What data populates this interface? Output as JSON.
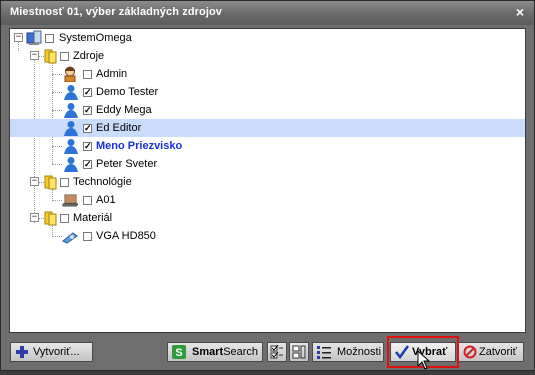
{
  "window": {
    "title": "Miestnosť 01, výber základných zdrojov",
    "close_label": "×"
  },
  "tree": {
    "root": {
      "label": "SystemOmega",
      "checked": false,
      "icon": "system-icon"
    },
    "groups": [
      {
        "label": "Zdroje",
        "checked": false,
        "icon": "folder-icon",
        "items": [
          {
            "label": "Admin",
            "checked": false,
            "icon": "admin-user-icon",
            "selected": false,
            "highlight": false
          },
          {
            "label": "Demo Tester",
            "checked": true,
            "icon": "user-icon",
            "selected": false,
            "highlight": false
          },
          {
            "label": "Eddy Mega",
            "checked": true,
            "icon": "user-icon",
            "selected": false,
            "highlight": false
          },
          {
            "label": "Ed Editor",
            "checked": true,
            "icon": "user-icon",
            "selected": true,
            "highlight": false
          },
          {
            "label": "Meno Priezvisko",
            "checked": true,
            "icon": "user-icon",
            "selected": false,
            "highlight": true
          },
          {
            "label": "Peter Sveter",
            "checked": true,
            "icon": "user-icon",
            "selected": false,
            "highlight": false
          }
        ]
      },
      {
        "label": "Technológie",
        "checked": false,
        "icon": "folder-icon",
        "items": [
          {
            "label": "A01",
            "checked": false,
            "icon": "laptop-icon"
          }
        ]
      },
      {
        "label": "Materiál",
        "checked": false,
        "icon": "folder-icon",
        "items": [
          {
            "label": "VGA HD850",
            "checked": false,
            "icon": "hardware-icon"
          }
        ]
      }
    ]
  },
  "toolbar": {
    "create_label": "Vytvoriť...",
    "smartsearch_bold": "Smart",
    "smartsearch_rest": "Search",
    "options_label": "Možnosti",
    "select_label": "Vybrať",
    "close_label": "Zatvoriť"
  },
  "colors": {
    "selected_row": "#c9dcfb",
    "highlight_text": "#1a2fd8",
    "annotation_box": "#e01010"
  }
}
